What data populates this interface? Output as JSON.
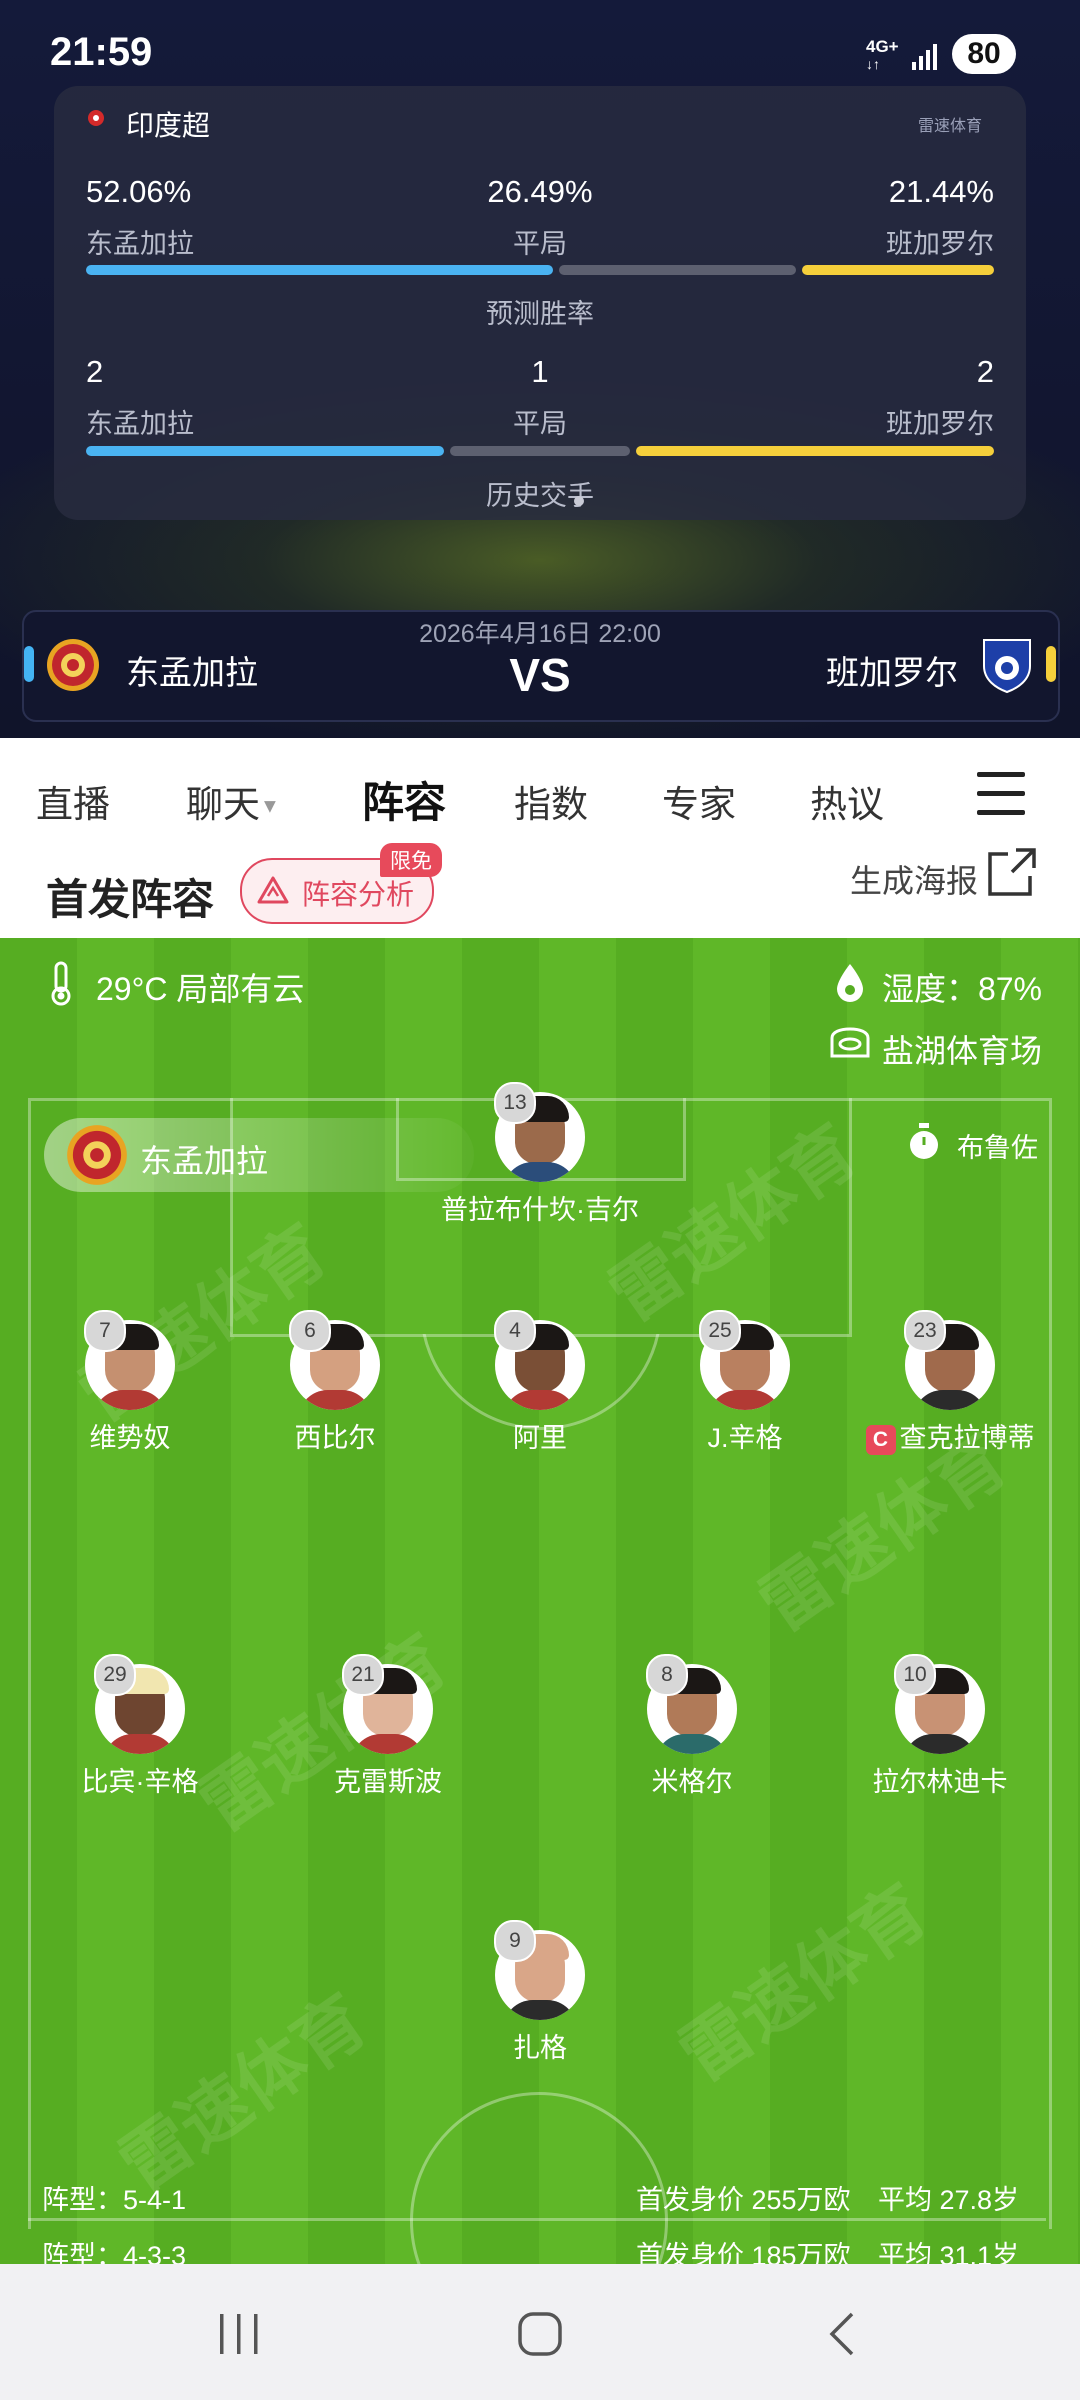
{
  "status_bar": {
    "time": "21:59",
    "network": "4G+",
    "battery": "80"
  },
  "prediction": {
    "league": "印度超",
    "brand": "雷速体育",
    "win_rate": {
      "home": {
        "pct": "52.06%",
        "team": "东孟加拉",
        "value": 52.06
      },
      "draw": {
        "pct": "26.49%",
        "label": "平局",
        "value": 26.49
      },
      "away": {
        "pct": "21.44%",
        "team": "班加罗尔",
        "value": 21.44
      },
      "caption": "预测胜率"
    },
    "history": {
      "home": {
        "count": "2",
        "team": "东孟加拉",
        "value": 2
      },
      "draw": {
        "count": "1",
        "label": "平局",
        "value": 1
      },
      "away": {
        "count": "2",
        "team": "班加罗尔",
        "value": 2
      },
      "caption": "历史交手"
    }
  },
  "match": {
    "home_team": "东孟加拉",
    "away_team": "班加罗尔",
    "datetime": "2026年4月16日 22:00",
    "vs": "VS",
    "home_color": "#44b4f4",
    "away_color": "#f5cf3b"
  },
  "tabs": [
    {
      "label": "直播"
    },
    {
      "label": "聊天"
    },
    {
      "label": "阵容",
      "active": true
    },
    {
      "label": "指数"
    },
    {
      "label": "专家"
    },
    {
      "label": "热议"
    }
  ],
  "lineup": {
    "title": "首发阵容",
    "analysis_label": "阵容分析",
    "free_badge": "限免",
    "poster_label": "生成海报"
  },
  "pitch": {
    "weather": "29°C 局部有云",
    "humidity": "湿度：87%",
    "stadium": "盐湖体育场",
    "home_team": "东孟加拉",
    "coach": "布鲁佐",
    "watermark": "雷速体育",
    "captain_mark": "C",
    "players": [
      {
        "number": "13",
        "name": "普拉布什坎·吉尔"
      },
      {
        "number": "7",
        "name": "维势奴"
      },
      {
        "number": "6",
        "name": "西比尔"
      },
      {
        "number": "4",
        "name": "阿里"
      },
      {
        "number": "25",
        "name": "J.辛格"
      },
      {
        "number": "23",
        "name": "查克拉博蒂"
      },
      {
        "number": "29",
        "name": "比宾·辛格"
      },
      {
        "number": "21",
        "name": "克雷斯波"
      },
      {
        "number": "8",
        "name": "米格尔"
      },
      {
        "number": "10",
        "name": "拉尔林迪卡"
      },
      {
        "number": "9",
        "name": "扎格"
      }
    ],
    "home_formation": "阵型：5-4-1",
    "home_value": "首发身价 255万欧",
    "home_age": "平均 27.8岁",
    "away_formation": "阵型：4-3-3",
    "away_value": "首发身价 185万欧",
    "away_age": "平均 31.1岁"
  }
}
